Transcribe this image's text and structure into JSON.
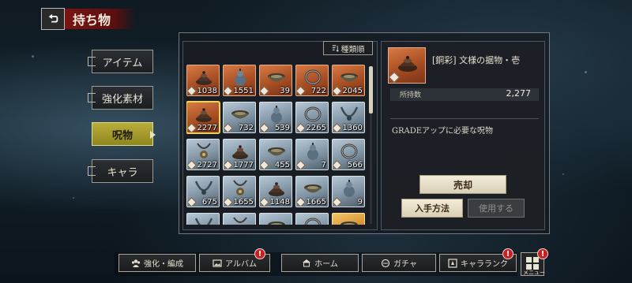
{
  "header": {
    "title": "持ち物"
  },
  "categories": [
    {
      "label": "アイテム",
      "active": false
    },
    {
      "label": "強化素材",
      "active": false
    },
    {
      "label": "呪物",
      "active": true
    },
    {
      "label": "キャラ",
      "active": false
    }
  ],
  "sort_label": "種類順",
  "grid": {
    "items": [
      {
        "count": "1038",
        "rarity": "copper",
        "icon": "incense-burner-icon"
      },
      {
        "count": "1551",
        "rarity": "copper",
        "icon": "gourd-icon"
      },
      {
        "count": "39",
        "rarity": "copper",
        "icon": "bowl-icon"
      },
      {
        "count": "722",
        "rarity": "copper",
        "icon": "bracelet-icon"
      },
      {
        "count": "2045",
        "rarity": "copper",
        "icon": "bowl-icon"
      },
      {
        "count": "2277",
        "rarity": "copper",
        "icon": "incense-burner-icon",
        "selected": true
      },
      {
        "count": "732",
        "rarity": "silver",
        "icon": "bowl-icon"
      },
      {
        "count": "539",
        "rarity": "silver",
        "icon": "gourd-icon"
      },
      {
        "count": "2265",
        "rarity": "silver",
        "icon": "bracelet-icon"
      },
      {
        "count": "1360",
        "rarity": "silver",
        "icon": "necklace-icon"
      },
      {
        "count": "2727",
        "rarity": "silver",
        "icon": "pendant-icon"
      },
      {
        "count": "1777",
        "rarity": "silver",
        "icon": "incense-burner-icon"
      },
      {
        "count": "455",
        "rarity": "silver",
        "icon": "bowl-icon"
      },
      {
        "count": "7",
        "rarity": "silver",
        "icon": "gourd-icon"
      },
      {
        "count": "566",
        "rarity": "silver",
        "icon": "bracelet-icon"
      },
      {
        "count": "675",
        "rarity": "silver",
        "icon": "necklace-icon"
      },
      {
        "count": "1655",
        "rarity": "silver",
        "icon": "pendant-icon"
      },
      {
        "count": "1148",
        "rarity": "silver",
        "icon": "incense-burner-icon"
      },
      {
        "count": "1665",
        "rarity": "silver",
        "icon": "bowl-icon"
      },
      {
        "count": "9",
        "rarity": "silver",
        "icon": "gourd-icon"
      },
      {
        "count": "",
        "rarity": "silver",
        "icon": "necklace-icon"
      },
      {
        "count": "",
        "rarity": "silver",
        "icon": "pendant-icon"
      },
      {
        "count": "",
        "rarity": "silver",
        "icon": "bowl-icon"
      },
      {
        "count": "",
        "rarity": "silver",
        "icon": "bracelet-icon"
      },
      {
        "count": "",
        "rarity": "gold",
        "icon": "bowl-icon"
      }
    ]
  },
  "detail": {
    "name": "[銅彩] 文様の据物・壱",
    "owned_label": "所持数",
    "owned_value": "2,277",
    "description": "GRADEアップに必要な呪物",
    "sell_label": "売却",
    "acquire_label": "入手方法",
    "use_label": "使用する"
  },
  "nav": {
    "enhance_label": "強化・編成",
    "album_label": "アルバム",
    "home_label": "ホーム",
    "gacha_label": "ガチャ",
    "rank_label": "キャラランク",
    "menu_label": "メニュー",
    "alert_mark": "!"
  },
  "colors": {
    "copper": "#b85a2c",
    "silver": "#8ea2b2",
    "gold": "#d8952f",
    "active_tab": "#a89d2e",
    "header_red": "#7b1414",
    "alert_red": "#c82020"
  }
}
